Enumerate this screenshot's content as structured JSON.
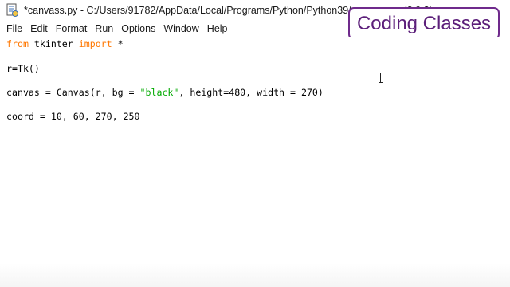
{
  "window": {
    "title": "*canvass.py - C:/Users/91782/AppData/Local/Programs/Python/Python39/canvass.py (3.9.2)"
  },
  "menu": {
    "items": [
      "File",
      "Edit",
      "Format",
      "Run",
      "Options",
      "Window",
      "Help"
    ]
  },
  "watermark": {
    "text": "Coding Classes"
  },
  "editor": {
    "lines": {
      "l1": {
        "kw1": "from",
        "mid": " tkinter ",
        "kw2": "import",
        "end": " *"
      },
      "l2": {
        "text": "r=Tk()"
      },
      "l3": {
        "pre": "canvas = Canvas(r, bg = ",
        "str": "\"black\"",
        "post": ", height=480, width = 270)"
      },
      "l4": {
        "text": "coord = 10, 60, 270, 250"
      }
    }
  },
  "colors": {
    "keyword": "#ff7700",
    "string": "#00aa00",
    "watermark_border": "#6f2a8c"
  }
}
